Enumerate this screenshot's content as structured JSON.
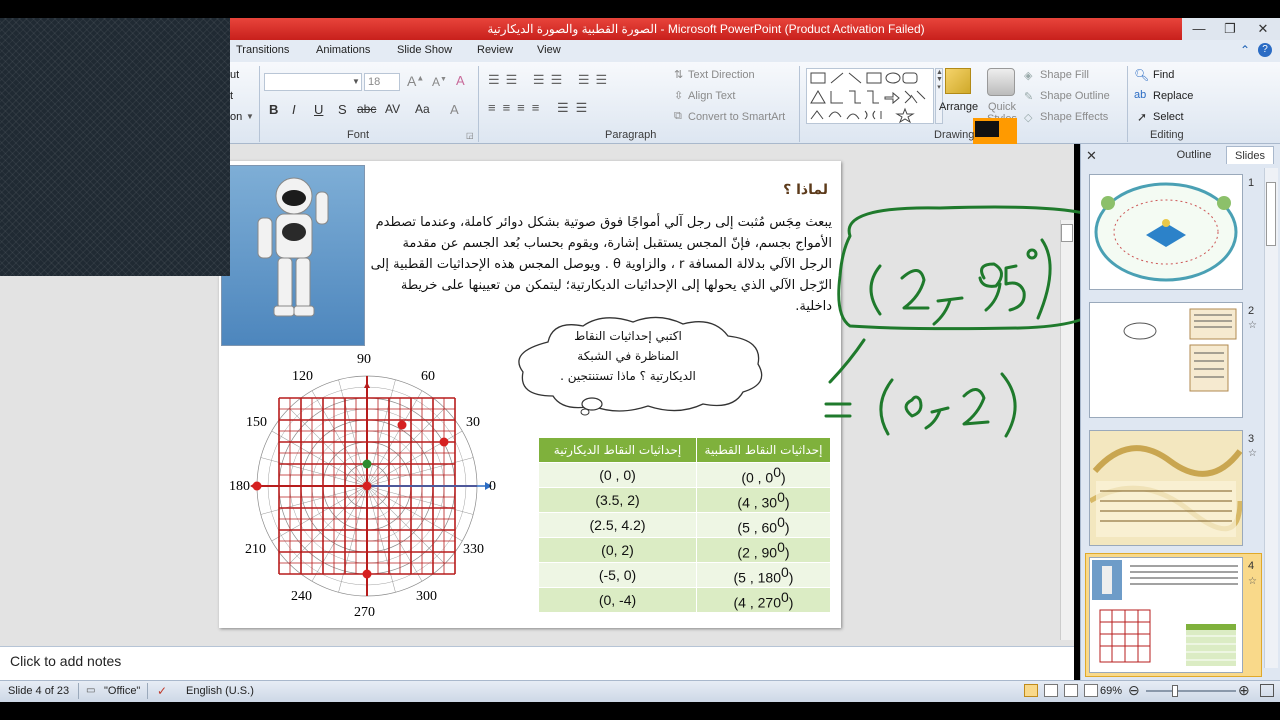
{
  "window": {
    "title": "الصورة القطبية والصورة الديكارتية  -  Microsoft PowerPoint (Product Activation Failed)",
    "min": "—",
    "max": "❐",
    "close": "✕"
  },
  "tabs": [
    "Transitions",
    "Animations",
    "Slide Show",
    "Review",
    "View"
  ],
  "ribbon": {
    "clipboard_partial": [
      "ut",
      "t",
      "on"
    ],
    "font": {
      "label": "Font",
      "size": "18"
    },
    "paragraph": {
      "label": "Paragraph",
      "text_direction": "Text Direction",
      "align_text": "Align Text",
      "convert_smartart": "Convert to SmartArt"
    },
    "drawing": {
      "label": "Drawing",
      "arrange": "Arrange",
      "quick_styles": "Quick Styles",
      "shape_fill": "Shape Fill",
      "shape_outline": "Shape Outline",
      "shape_effects": "Shape Effects"
    },
    "editing": {
      "label": "Editing",
      "find": "Find",
      "replace": "Replace",
      "select": "Select"
    }
  },
  "slide": {
    "heading": "لماذا ؟",
    "paragraph": "يبعث مِجَس مُثبت إلى رجل آلي أمواجًا فوق صوتية بشكل دوائر كاملة، وعندما تصطدم الأمواج بجسم، فإنّ المجس يستقبل إشارة، ويقوم بحساب بُعد الجسم عن مقدمة الرجل الآلي بدلالة المسافة r ، والزاوية θ . ويوصل المجس هذه الإحداثيات القطبية إلى الرّجل الآلي الذي يحولها إلى الإحداثيات الديكارتية؛ ليتمكن من تعيينها على خريطة داخلية.",
    "cloud": [
      "اكتبي إحداثيات النقاط",
      "المناظرة  في الشبكة",
      "الديكارتية  ؟ ماذا تستنتجين ."
    ],
    "polar_labels": [
      "90",
      "120",
      "60",
      "150",
      "30",
      "180",
      "0",
      "210",
      "330",
      "240",
      "300",
      "270"
    ],
    "table": {
      "headers": [
        "إحداثيات النقاط القطبية",
        "إحداثيات النقاط  الديكارتية"
      ],
      "rows": [
        [
          "(0 , 0",
          "0",
          ")",
          "(0 , 0)"
        ],
        [
          "(4 , 30",
          "0",
          ")",
          "(3.5, 2)"
        ],
        [
          "(5 , 60",
          "0",
          ")",
          "(2.5, 4.2)"
        ],
        [
          "(2 , 90",
          "0",
          ")",
          "(0, 2)"
        ],
        [
          "(5 , 180",
          "0",
          ")",
          "(-5, 0)"
        ],
        [
          "(4 , 270",
          "0",
          ")",
          "(0, -4)"
        ]
      ]
    }
  },
  "notes": "Click to add notes",
  "panel": {
    "tab_outline": "Outline",
    "tab_slides": "Slides",
    "numbers": [
      "1",
      "2",
      "3",
      "4"
    ]
  },
  "status": {
    "slide": "Slide 4 of 23",
    "theme": "\"Office\"",
    "language": "English (U.S.)",
    "zoom": "69%"
  },
  "colors": {
    "accent_red": "#d9322b",
    "table_green": "#7fb13c",
    "ink_green": "#1f7a2c",
    "grid_red": "#b71c1c"
  }
}
